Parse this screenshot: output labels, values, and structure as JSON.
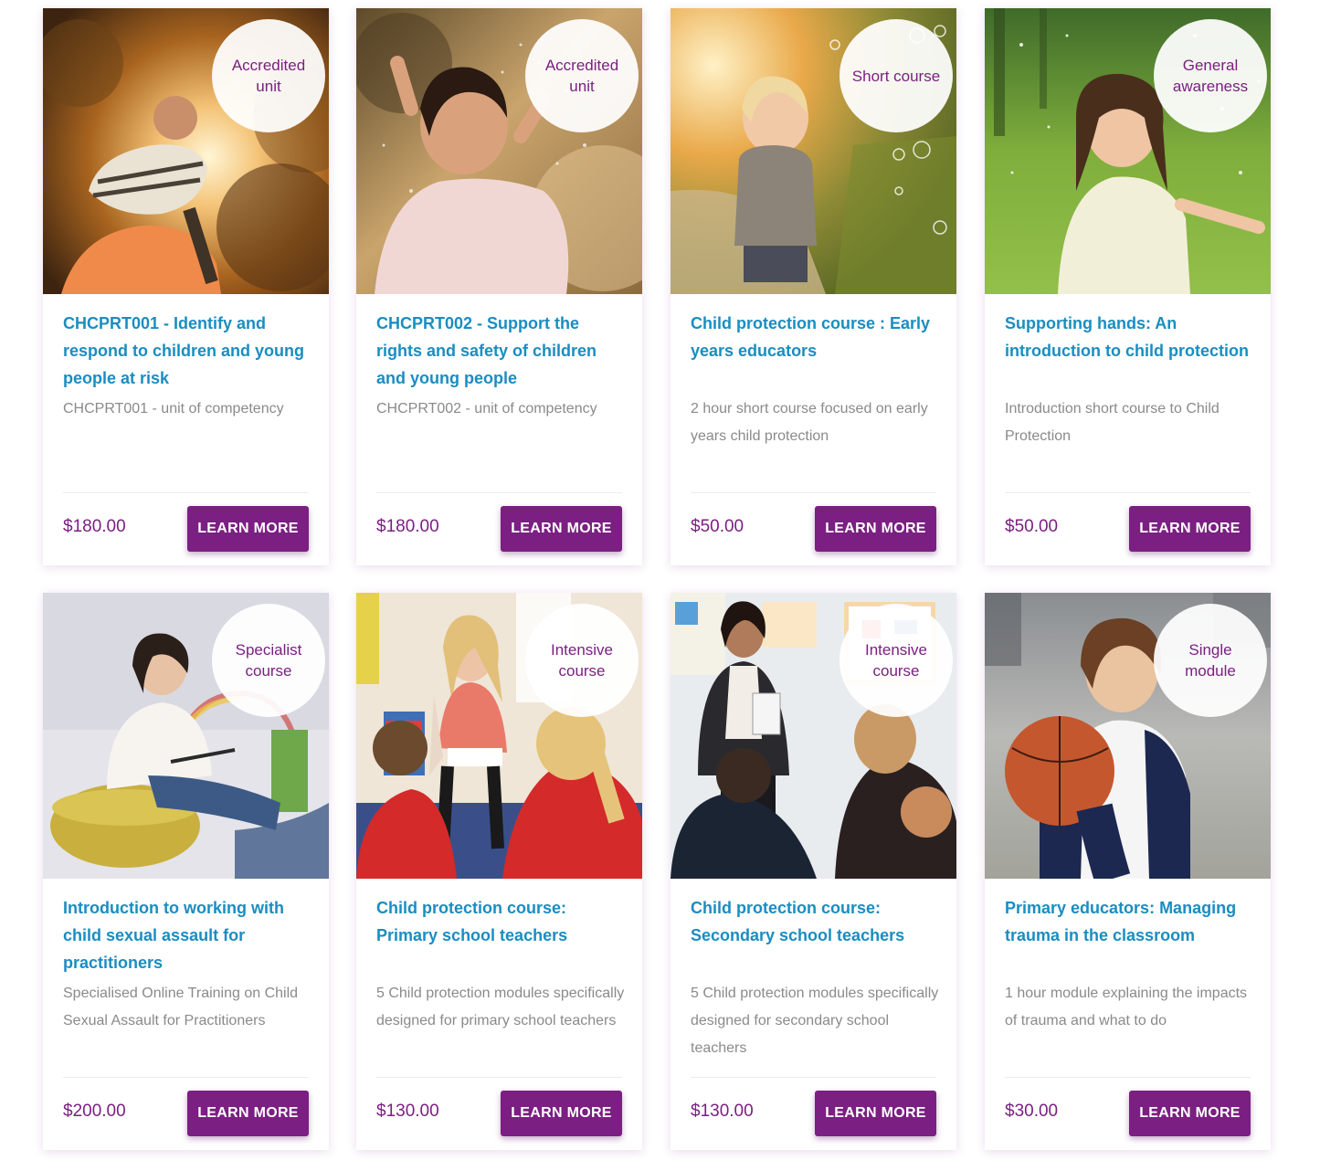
{
  "courses": [
    {
      "badge": "Accredited unit",
      "title": "CHCPRT001 - Identify and respond to children and young people at risk",
      "description": "CHCPRT001 - unit of competency",
      "price": "$180.00",
      "button": "LEARN MORE",
      "image": "father-carrying-child-on-shoulders-sunset"
    },
    {
      "badge": "Accredited unit",
      "title": "CHCPRT002 - Support the rights and safety of children and young people",
      "description": "CHCPRT002 - unit of competency",
      "price": "$180.00",
      "button": "LEARN MORE",
      "image": "laughing-girl-playing-in-water"
    },
    {
      "badge": "Short course",
      "title": "Child protection course : Early years educators",
      "description": "2 hour short course focused on early years child protection",
      "price": "$50.00",
      "button": "LEARN MORE",
      "image": "toddler-with-bubbles-on-path"
    },
    {
      "badge": "General awareness",
      "title": "Supporting hands: An introduction to child protection",
      "description": "Introduction short course to Child Protection",
      "price": "$50.00",
      "button": "LEARN MORE",
      "image": "girl-running-in-grass"
    },
    {
      "badge": "Specialist course",
      "title": "Introduction to working with child sexual assault for practitioners",
      "description": "Specialised Online Training on Child Sexual Assault for Practitioners",
      "price": "$200.00",
      "button": "LEARN MORE",
      "image": "practitioner-with-clipboard"
    },
    {
      "badge": "Intensive course",
      "title": "Child protection course: Primary school teachers",
      "description": "5 Child protection modules specifically designed for primary school teachers",
      "price": "$130.00",
      "button": "LEARN MORE",
      "image": "teacher-reading-to-class"
    },
    {
      "badge": "Intensive course",
      "title": "Child protection course: Secondary school teachers",
      "description": "5 Child protection modules specifically designed for secondary school teachers",
      "price": "$130.00",
      "button": "LEARN MORE",
      "image": "teacher-standing-in-classroom"
    },
    {
      "badge": "Single module",
      "title": "Primary educators: Managing trauma in the classroom",
      "description": "1 hour module explaining the impacts of trauma and what to do",
      "price": "$30.00",
      "button": "LEARN MORE",
      "image": "boy-with-basketball"
    }
  ],
  "colors": {
    "brand_purple": "#7b1f82",
    "title_blue": "#1a8dc1",
    "description_gray": "#8a8a8a"
  }
}
